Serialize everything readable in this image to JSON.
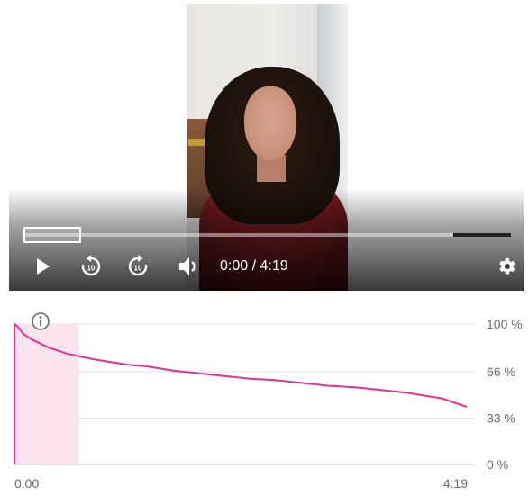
{
  "player": {
    "time_current": "0:00",
    "time_separator": " / ",
    "time_total": "4:19",
    "progress_fraction": 0.0,
    "icons": {
      "play": "play-icon",
      "rewind": "replay-10-icon",
      "forward": "forward-10-icon",
      "volume": "volume-icon",
      "settings": "gear-icon"
    },
    "rewind_seconds": "10",
    "forward_seconds": "10"
  },
  "chart_data": {
    "type": "area",
    "title": "",
    "xlabel": "",
    "ylabel": "",
    "x_ticks": [
      "0:00",
      "4:19"
    ],
    "y_ticks": [
      "100 %",
      "66 %",
      "33 %",
      "0 %"
    ],
    "y_tick_values": [
      100,
      66,
      33,
      0
    ],
    "xlim": [
      0,
      259
    ],
    "ylim": [
      0,
      100
    ],
    "grid": true,
    "info_icon": "info-icon",
    "highlight_range": [
      0,
      37
    ],
    "series": [
      {
        "color": "#e0338f",
        "x": [
          0,
          2,
          5,
          10,
          15,
          20,
          25,
          30,
          37,
          45,
          55,
          65,
          75,
          90,
          105,
          120,
          135,
          150,
          165,
          180,
          195,
          210,
          225,
          235,
          245,
          252,
          259
        ],
        "y": [
          100,
          98,
          93,
          89,
          86,
          83,
          81,
          79,
          77,
          75,
          73,
          71,
          70,
          67,
          65,
          63,
          61,
          60,
          58,
          56,
          55,
          53,
          51,
          49,
          47,
          44,
          41
        ]
      }
    ],
    "colors": {
      "line": "#e0338f",
      "highlight": "#fbe4ee",
      "grid": "#e2e2e2",
      "axis": "#c8c8c8"
    }
  }
}
